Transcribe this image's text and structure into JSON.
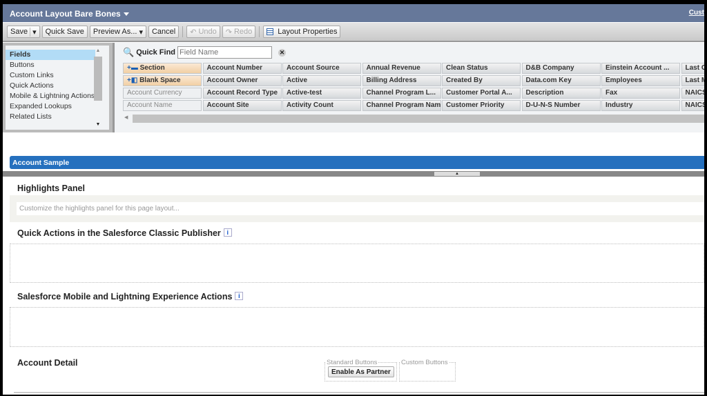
{
  "header": {
    "title": "Account Layout Bare Bones",
    "right_link": "Cust"
  },
  "toolbar": {
    "save": "Save",
    "quick_save": "Quick Save",
    "preview_as": "Preview As...",
    "cancel": "Cancel",
    "undo": "Undo",
    "redo": "Redo",
    "layout_properties": "Layout Properties"
  },
  "palette": {
    "categories": [
      {
        "label": "Fields",
        "selected": true
      },
      {
        "label": "Buttons"
      },
      {
        "label": "Custom Links"
      },
      {
        "label": "Quick Actions"
      },
      {
        "label": "Mobile & Lightning Actions"
      },
      {
        "label": "Expanded Lookups"
      },
      {
        "label": "Related Lists"
      }
    ],
    "quick_find_label": "Quick Find",
    "quick_find_placeholder": "Field Name",
    "rows": [
      [
        "Section",
        "Account Number",
        "Account Source",
        "Annual Revenue",
        "Clean Status",
        "D&B Company",
        "Einstein Account ...",
        "Last Co"
      ],
      [
        "Blank Space",
        "Account Owner",
        "Active",
        "Billing Address",
        "Created By",
        "Data.com Key",
        "Employees",
        "Last Mo"
      ],
      [
        "Account Currency",
        "Account Record Type",
        "Active-test",
        "Channel Program L...",
        "Customer Portal A...",
        "Description",
        "Fax",
        "NAICS C"
      ],
      [
        "Account Name",
        "Account Site",
        "Activity Count",
        "Channel Program Name",
        "Customer Priority",
        "D-U-N-S Number",
        "Industry",
        "NAICS D"
      ]
    ],
    "used_fields": [
      "Account Currency",
      "Account Name"
    ],
    "special_fields": [
      "Section",
      "Blank Space"
    ]
  },
  "layout": {
    "sample_title": "Account Sample",
    "highlights_title": "Highlights Panel",
    "highlights_hint": "Customize the highlights panel for this page layout...",
    "quick_actions_title": "Quick Actions in the Salesforce Classic Publisher",
    "mobile_actions_title": "Salesforce Mobile and Lightning Experience Actions",
    "detail_title": "Account Detail",
    "standard_buttons_label": "Standard Buttons",
    "custom_buttons_label": "Custom Buttons",
    "standard_buttons": [
      "Enable As Partner"
    ]
  },
  "colors": {
    "header": "#66789a",
    "section_bar": "#2570be",
    "palette_special": "#f1cfa4"
  }
}
